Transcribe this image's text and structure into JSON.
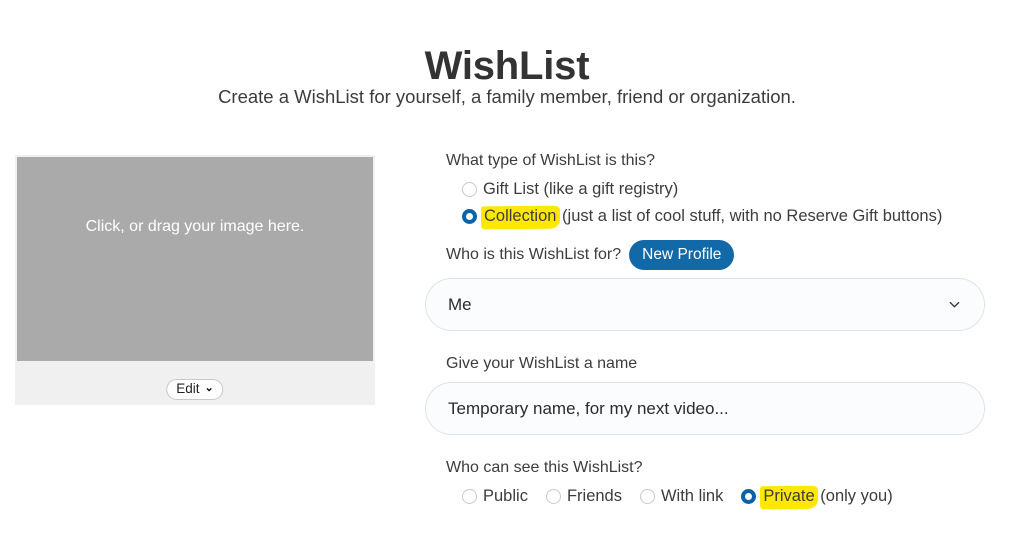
{
  "header": {
    "title": "WishList",
    "subtitle": "Create a WishList for yourself, a family member, friend or organization."
  },
  "image_uploader": {
    "drop_text": "Click, or drag your image here.",
    "edit_label": "Edit",
    "edit_chevron_icon": "chevron-down-icon",
    "placeholder_color": "#aaaaaa",
    "footer_color": "#f0f0f0"
  },
  "form": {
    "type_question": "What type of WishList is this?",
    "type_options": [
      {
        "label_plain": "Gift List (like a gift registry)",
        "highlight": "",
        "rest": "Gift List (like a gift registry)",
        "selected": false
      },
      {
        "label_plain": "Collection (just a list of cool stuff, with no Reserve Gift buttons)",
        "highlight": "Collection",
        "rest": " (just a list of cool stuff, with no Reserve Gift buttons)",
        "selected": true
      }
    ],
    "who_question": "Who is this WishList for?",
    "new_profile_label": "New Profile",
    "profile_select_value": "Me",
    "profile_select_options": [
      "Me"
    ],
    "name_label": "Give your WishList a name",
    "name_value": "Temporary name, for my next video...",
    "name_placeholder": "Give your WishList a name",
    "visibility_question": "Who can see this WishList?",
    "visibility_options": [
      {
        "highlight": "",
        "rest": "Public",
        "selected": false
      },
      {
        "highlight": "",
        "rest": "Friends",
        "selected": false
      },
      {
        "highlight": "",
        "rest": "With link",
        "selected": false
      },
      {
        "highlight": "Private",
        "rest": " (only you)",
        "selected": true
      }
    ]
  },
  "colors": {
    "accent_blue": "#1269a8",
    "radio_selected": "#0a63a8",
    "highlight_yellow": "#ffe800",
    "title_gray": "#333333",
    "image_placeholder_gray": "#aaaaaa"
  }
}
